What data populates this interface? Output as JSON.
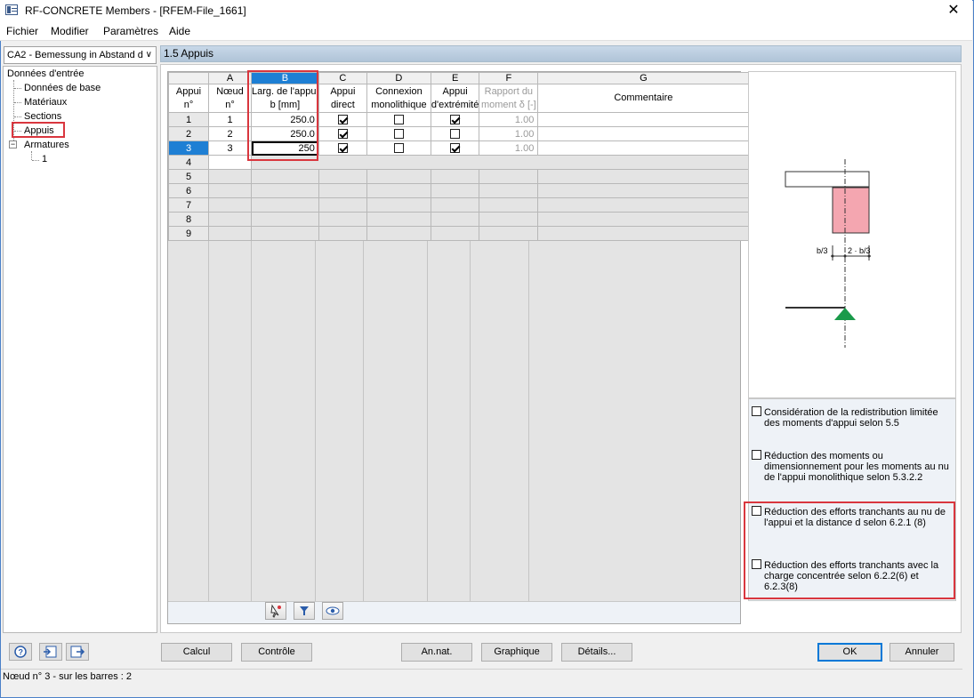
{
  "window": {
    "title": "RF-CONCRETE Members - [RFEM-File_1661]",
    "close_symbol": "✕"
  },
  "menu": [
    "Fichier",
    "Modifier",
    "Paramètres",
    "Aide"
  ],
  "case_selector": {
    "value": "CA2 - Bemessung in Abstand d",
    "arrow": "∨"
  },
  "tree": {
    "root": "Données d'entrée",
    "items": [
      "Données de base",
      "Matériaux",
      "Sections",
      "Appuis"
    ],
    "armatures": "Armatures",
    "armatures_child": "1",
    "expand_symbol": "−"
  },
  "section": {
    "title": "1.5 Appuis"
  },
  "grid": {
    "letters": [
      "A",
      "B",
      "C",
      "D",
      "E",
      "F",
      "G"
    ],
    "headers": {
      "row": [
        "Appui",
        "n°"
      ],
      "A": [
        "Nœud",
        "n°"
      ],
      "B": [
        "Larg. de l'appui",
        "b [mm]"
      ],
      "C": [
        "Appui",
        "direct"
      ],
      "D": [
        "Connexion",
        "monolithique"
      ],
      "E": [
        "Appui",
        "d'extrémité"
      ],
      "F": [
        "Rapport du",
        "moment δ [-]"
      ],
      "G": [
        "",
        "Commentaire"
      ]
    },
    "rows": [
      {
        "num": "1",
        "node": "1",
        "width": "250.0",
        "direct": true,
        "mono": false,
        "end": true,
        "ratio": "1.00",
        "comment": ""
      },
      {
        "num": "2",
        "node": "2",
        "width": "250.0",
        "direct": true,
        "mono": false,
        "end": false,
        "ratio": "1.00",
        "comment": ""
      },
      {
        "num": "3",
        "node": "3",
        "width": "250",
        "direct": true,
        "mono": false,
        "end": true,
        "ratio": "1.00",
        "comment": ""
      }
    ],
    "empty_rows": [
      "4",
      "5",
      "6",
      "7",
      "8",
      "9"
    ],
    "selected_row": "3",
    "selected_column": "B"
  },
  "toolbar_icons": [
    "pick-icon",
    "filter-icon",
    "view-icon"
  ],
  "figure": {
    "label_left": "b/3",
    "label_right": "2 · b/3"
  },
  "options": [
    {
      "label": "Considération de la redistribution limitée des moments d'appui selon 5.5",
      "checked": false
    },
    {
      "label": "Réduction des moments ou dimensionnement pour les moments au nu de l'appui monolithique selon 5.3.2.2",
      "checked": false
    },
    {
      "label": "Réduction des efforts tranchants au nu de l'appui et la distance d selon 6.2.1 (8)",
      "checked": false
    },
    {
      "label": "Réduction des efforts tranchants avec la charge concentrée selon 6.2.2(6) et 6.2.3(8)",
      "checked": false
    }
  ],
  "buttons": {
    "calcul": "Calcul",
    "controle": "Contrôle",
    "annat": "An.nat.",
    "graphique": "Graphique",
    "details": "Détails...",
    "ok": "OK",
    "annuler": "Annuler"
  },
  "status": "Nœud n° 3  -  sur les barres : 2",
  "colors": {
    "selection": "#1e7fd4",
    "highlight": "#d9363e",
    "support_fill": "#f4a6b0",
    "support_triangle": "#1a9a4a"
  }
}
